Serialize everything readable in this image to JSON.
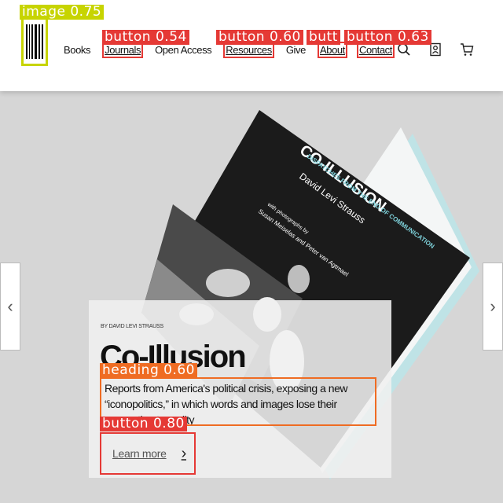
{
  "nav": {
    "items": [
      {
        "label": "Books",
        "boxed": false
      },
      {
        "label": "Journals",
        "boxed": true
      },
      {
        "label": "Open Access",
        "boxed": false
      },
      {
        "label": "Resources",
        "boxed": true
      },
      {
        "label": "Give",
        "boxed": false
      },
      {
        "label": "About",
        "boxed": true
      },
      {
        "label": "Contact",
        "boxed": true
      }
    ],
    "icons": [
      "search-icon",
      "account-icon",
      "cart-icon"
    ]
  },
  "annotations": {
    "image": "image 0.75",
    "button_journals": "button 0.54",
    "button_resources": "button 0.60",
    "button_about": "butt",
    "button_contact": "button 0.63",
    "heading": "heading 0.60",
    "button_learn": "button 0.80"
  },
  "book": {
    "title": "CO-ILLUSION",
    "subtitle": "DISPATCHES FROM THE END OF COMMUNICATION",
    "author": "David Levi Strauss",
    "photo_credit_line1": "with photographs by",
    "photo_credit_line2": "Susan Meiselas and Peter van Agtmael"
  },
  "card": {
    "byline": "BY DAVID LEVI STRAUSS",
    "title": "Co-Illusion",
    "description": "Reports from America's political crisis, exposing a new “iconopolitics,” in which words and images lose their connection to reality",
    "button_label": "Learn more"
  },
  "arrows": {
    "left": "‹",
    "right": "›"
  },
  "colors": {
    "accent": "#c7d400",
    "annotation_red": "#e53935",
    "annotation_orange": "#ef6c23"
  }
}
